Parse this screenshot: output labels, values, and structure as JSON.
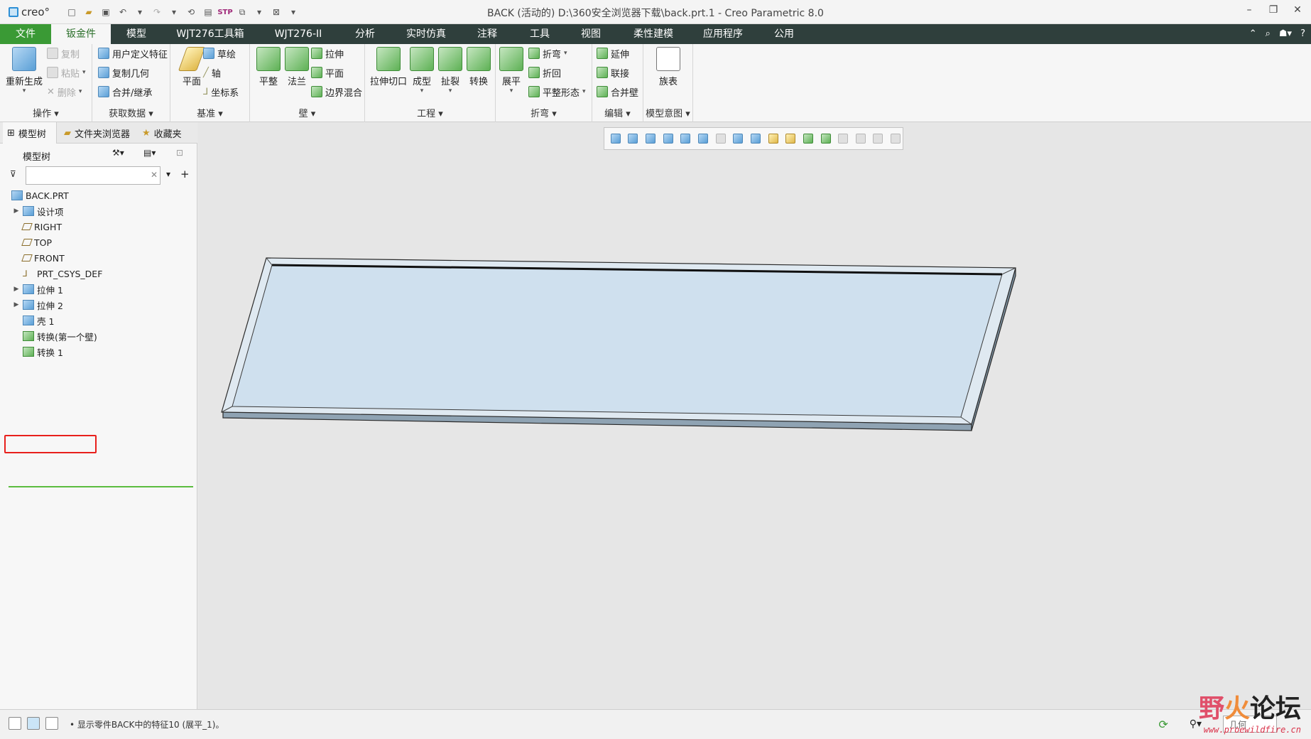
{
  "app": {
    "logo_text": "creo°",
    "title": "BACK (活动的) D:\\360安全浏览器下载\\back.prt.1 - Creo Parametric 8.0"
  },
  "menu": {
    "tabs": [
      "文件",
      "钣金件",
      "模型",
      "WJT276工具箱",
      "WJT276-II",
      "分析",
      "实时仿真",
      "注释",
      "工具",
      "视图",
      "柔性建模",
      "应用程序",
      "公用"
    ]
  },
  "ribbon": {
    "ops": {
      "regen": "重新生成",
      "copy": "复制",
      "paste": "粘贴",
      "delete": "删除",
      "label": "操作"
    },
    "getdata": {
      "udf": "用户定义特征",
      "copygeom": "复制几何",
      "merge": "合并/继承",
      "label": "获取数据"
    },
    "datum": {
      "plane": "平面",
      "sketch": "草绘",
      "axis": "轴",
      "csys": "坐标系",
      "label": "基准"
    },
    "wall": {
      "flat": "平整",
      "flange": "法兰",
      "extrude": "拉伸",
      "planar": "平面",
      "blend": "边界混合",
      "label": "壁"
    },
    "eng": {
      "extcut": "拉伸切口",
      "form": "成型",
      "rip": "扯裂",
      "convert": "转换",
      "label": "工程"
    },
    "bend": {
      "unbend": "展平",
      "bend": "折弯",
      "bendback": "折回",
      "flatpattern": "平整形态",
      "label": "折弯"
    },
    "edit": {
      "extend": "延伸",
      "join": "联接",
      "mergewall": "合并壁",
      "label": "编辑"
    },
    "intent": {
      "family": "族表",
      "label": "模型意图"
    }
  },
  "panel": {
    "tabs": [
      "模型树",
      "文件夹浏览器",
      "收藏夹"
    ],
    "tree_title": "模型树",
    "search_placeholder": "",
    "items": [
      {
        "label": "BACK.PRT"
      },
      {
        "label": "设计项"
      },
      {
        "label": "RIGHT"
      },
      {
        "label": "TOP"
      },
      {
        "label": "FRONT"
      },
      {
        "label": "PRT_CSYS_DEF"
      },
      {
        "label": "拉伸 1"
      },
      {
        "label": "拉伸 2"
      },
      {
        "label": "壳 1"
      },
      {
        "label": "转换(第一个壁)"
      },
      {
        "label": "转换 1"
      }
    ]
  },
  "status": {
    "message": "• 显示零件BACK中的特征10 (展平_1)。",
    "filter": "几何"
  },
  "watermark": {
    "main": "野火论坛",
    "url": "www.proewildfire.cn"
  },
  "colors": {
    "accent_green": "#3a9a35",
    "menubar": "#2f3f3c",
    "model_face": "#cfe0ee",
    "highlight_red": "#e8201c"
  }
}
